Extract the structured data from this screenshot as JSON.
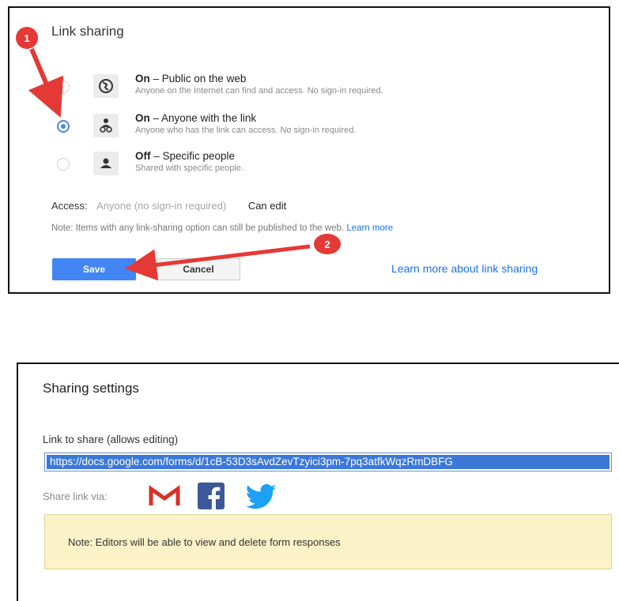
{
  "link_sharing": {
    "title": "Link sharing",
    "options": [
      {
        "state": "On",
        "label": " – Public on the web",
        "description": "Anyone on the Internet can find and access. No sign-in required.",
        "selected": false,
        "icon": "globe-icon"
      },
      {
        "state": "On",
        "label": " – Anyone with the link",
        "description": "Anyone who has the link can access. No sign-in required.",
        "selected": true,
        "icon": "people-link-icon"
      },
      {
        "state": "Off",
        "label": " – Specific people",
        "description": "Shared with specific people.",
        "selected": false,
        "icon": "person-icon"
      }
    ],
    "access": {
      "label": "Access:",
      "value": "Anyone (no sign-in required)",
      "permission": "Can edit"
    },
    "note": {
      "text": "Note: Items with any link-sharing option can still be published to the web.",
      "link": "Learn more"
    },
    "buttons": {
      "save": "Save",
      "cancel": "Cancel"
    },
    "learn_more_link": "Learn more about link sharing"
  },
  "annotations": {
    "badge1": "1",
    "badge2": "2",
    "color": "#e53935"
  },
  "sharing_settings": {
    "title": "Sharing settings",
    "link_label": "Link to share (allows editing)",
    "link_value": "https://docs.google.com/forms/d/1cB-53D3sAvdZevTzyici3pm-7pq3atfkWqzRmDBFG",
    "share_via_label": "Share link via:",
    "share_icons": [
      "gmail-icon",
      "facebook-icon",
      "twitter-icon"
    ],
    "note": "Note: Editors will be able to view and delete form responses"
  },
  "colors": {
    "accent": "#4285f4",
    "link": "#1a73e8",
    "note_bg": "#fcf2c8",
    "arrow": "#e53935"
  }
}
